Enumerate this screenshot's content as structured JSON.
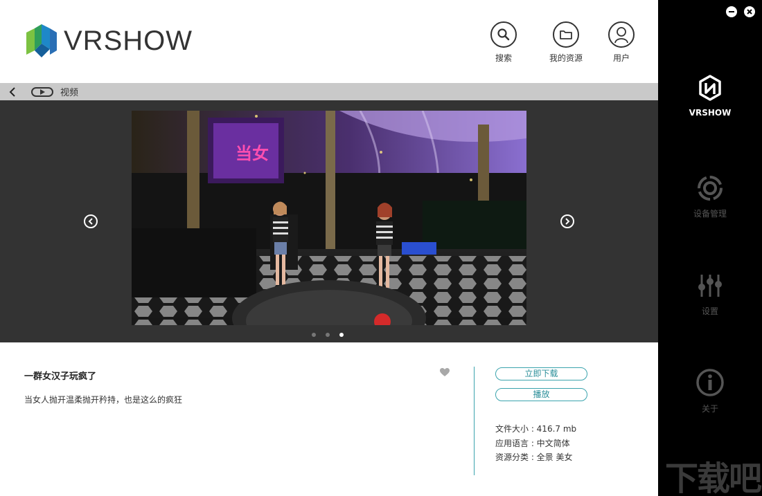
{
  "app": {
    "logo_text": "VRSHOW"
  },
  "header": {
    "search_label": "搜索",
    "resources_label": "我的资源",
    "user_label": "用户"
  },
  "breadcrumb": {
    "label": "视频"
  },
  "carousel": {
    "active_index": 2,
    "dot_count": 3,
    "slide_banner_text": "当女"
  },
  "detail": {
    "title": "一群女汉子玩疯了",
    "description": "当女人抛开温柔抛开矜持，也是这么的疯狂",
    "download_label": "立即下载",
    "play_label": "播放",
    "file_size": "文件大小 : 416.7 mb",
    "language": "应用语言 : 中文简体",
    "category": "资源分类 : 全景 美女"
  },
  "sidebar": {
    "items": [
      {
        "label": "VRSHOW",
        "icon": "vrshow-logo-icon",
        "active": true
      },
      {
        "label": "设备管理",
        "icon": "device-icon",
        "active": false
      },
      {
        "label": "设置",
        "icon": "sliders-icon",
        "active": false
      },
      {
        "label": "关于",
        "icon": "info-icon",
        "active": false
      }
    ]
  },
  "watermark": {
    "text": "下载吧"
  },
  "colors": {
    "accent": "#3aa3ad",
    "sidebar_bg": "#000000",
    "carousel_bg": "#333333",
    "breadcrumb_bg": "#c9c9c9"
  }
}
